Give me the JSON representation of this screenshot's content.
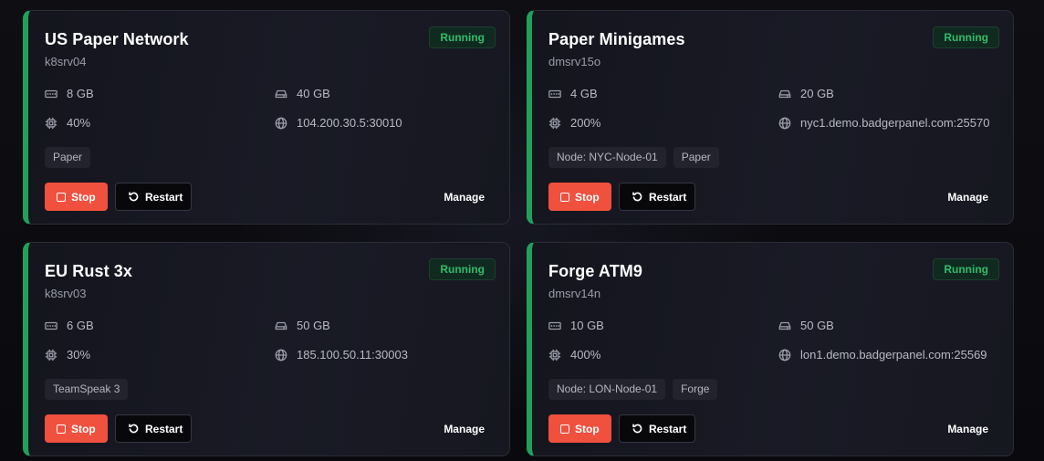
{
  "colors": {
    "accent_running": "#22a05a",
    "status_text": "#2ebd6b",
    "stop_button": "#f0503e"
  },
  "labels": {
    "stop": "Stop",
    "restart": "Restart",
    "manage": "Manage"
  },
  "servers": [
    {
      "name": "US Paper Network",
      "id": "k8srv04",
      "status": "Running",
      "ram": "8 GB",
      "disk": "40 GB",
      "cpu": "40%",
      "address": "104.200.30.5:30010",
      "tags": [
        "Paper"
      ]
    },
    {
      "name": "Paper Minigames",
      "id": "dmsrv15o",
      "status": "Running",
      "ram": "4 GB",
      "disk": "20 GB",
      "cpu": "200%",
      "address": "nyc1.demo.badgerpanel.com:25570",
      "tags": [
        "Node: NYC-Node-01",
        "Paper"
      ]
    },
    {
      "name": "EU Rust 3x",
      "id": "k8srv03",
      "status": "Running",
      "ram": "6 GB",
      "disk": "50 GB",
      "cpu": "30%",
      "address": "185.100.50.11:30003",
      "tags": [
        "TeamSpeak 3"
      ]
    },
    {
      "name": "Forge ATM9",
      "id": "dmsrv14n",
      "status": "Running",
      "ram": "10 GB",
      "disk": "50 GB",
      "cpu": "400%",
      "address": "lon1.demo.badgerpanel.com:25569",
      "tags": [
        "Node: LON-Node-01",
        "Forge"
      ]
    }
  ],
  "icons": {
    "ram": "memory-icon",
    "disk": "hard-drive-icon",
    "cpu": "cpu-icon",
    "network": "globe-icon",
    "stop": "stop-square-icon",
    "restart": "restart-icon"
  }
}
